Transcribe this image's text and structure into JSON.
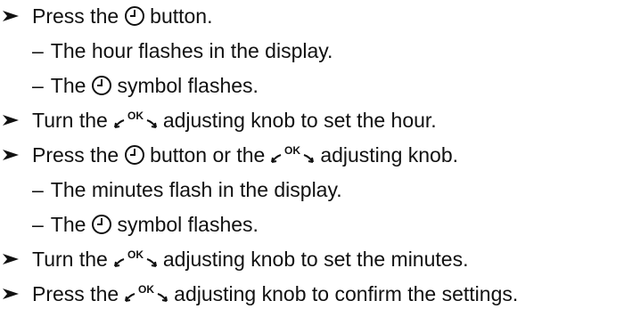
{
  "lines": [
    {
      "kind": "step",
      "parts": {
        "a": "Press the",
        "b": "button."
      }
    },
    {
      "kind": "sub",
      "parts": {
        "a": "The hour flashes in the display."
      }
    },
    {
      "kind": "sub",
      "parts": {
        "a": "The",
        "b": "symbol flashes."
      }
    },
    {
      "kind": "step",
      "parts": {
        "a": "Turn the",
        "b": "adjusting knob to set the hour."
      }
    },
    {
      "kind": "step",
      "parts": {
        "a": "Press the",
        "b": "button or the",
        "c": "adjusting knob."
      }
    },
    {
      "kind": "sub",
      "parts": {
        "a": "The minutes flash in the display."
      }
    },
    {
      "kind": "sub",
      "parts": {
        "a": "The",
        "b": "symbol flashes."
      }
    },
    {
      "kind": "step",
      "parts": {
        "a": "Turn the",
        "b": "adjusting knob to set the minutes."
      }
    },
    {
      "kind": "step",
      "parts": {
        "a": "Press the",
        "b": "adjusting knob to confirm the settings."
      }
    }
  ],
  "knob_label": "OK",
  "sub_dash": "–",
  "icons": {
    "clock": "clock-icon",
    "knob": "ok-adjusting-knob-icon",
    "bullet": "arrowhead-bullet-icon"
  }
}
